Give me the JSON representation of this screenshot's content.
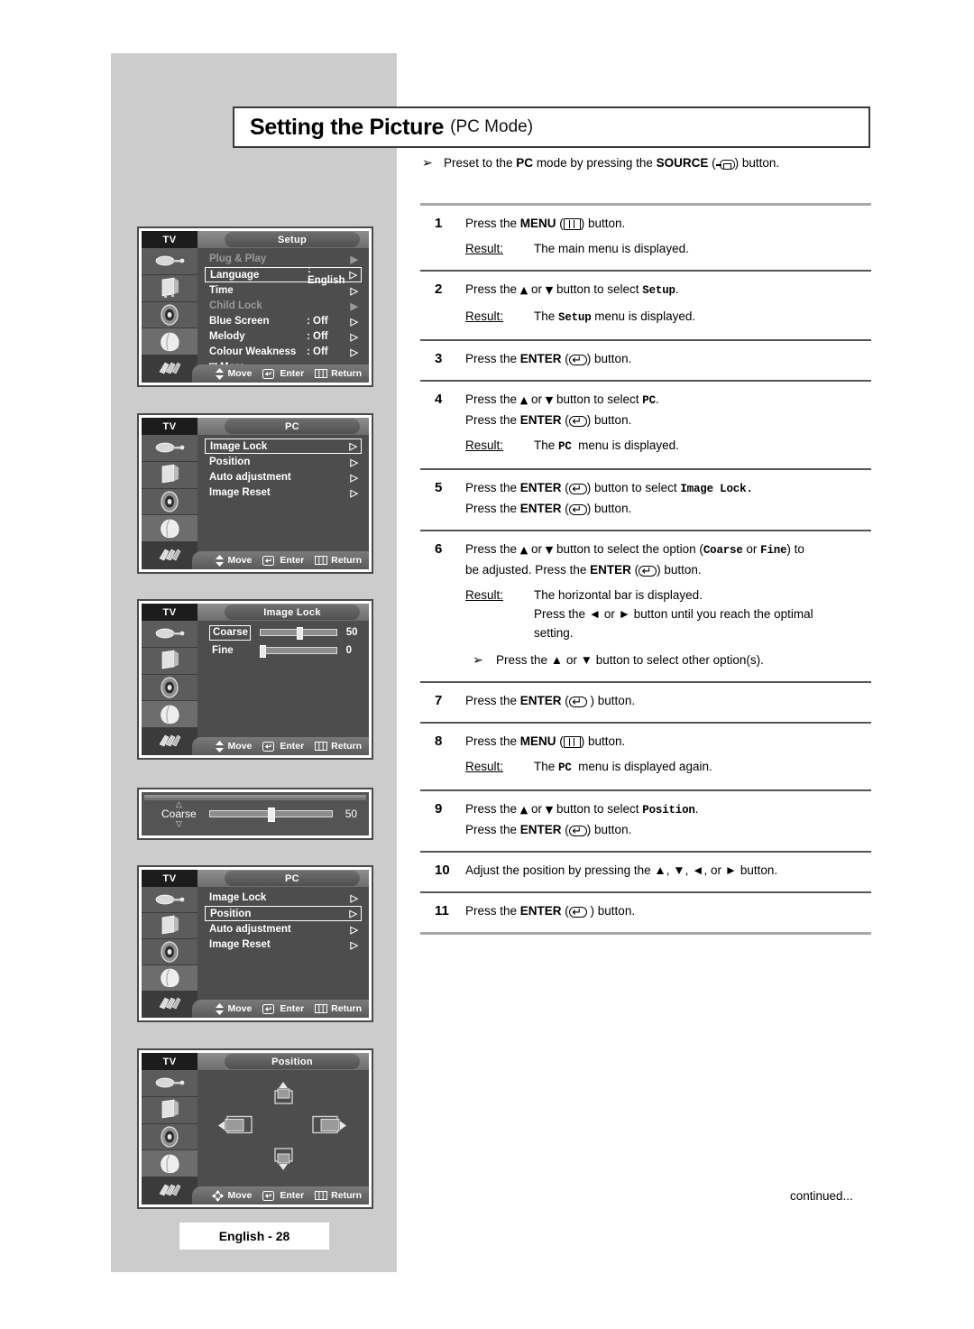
{
  "header": {
    "title_main": "Setting the Picture",
    "title_sub": "(PC Mode)"
  },
  "intro": {
    "bullet_glyph": "➢",
    "text_before": "Preset to the ",
    "bold_pc": "PC",
    "text_mid": " mode by pressing the ",
    "bold_source": "SOURCE",
    "text_after": " ) button.",
    "full": "Preset to the PC mode by pressing the SOURCE (  ) button."
  },
  "steps": [
    {
      "num": "1",
      "lines": [
        "Press the MENU (    ) button."
      ],
      "result_label": "Result:",
      "result_lines": [
        "The main menu is displayed."
      ]
    },
    {
      "num": "2",
      "lines": [
        "Press the ▲ or ▼ button to select Setup."
      ],
      "result_label": "Result:",
      "result_lines": [
        "The Setup menu is displayed."
      ]
    },
    {
      "num": "3",
      "lines": [
        "Press the ENTER (    ) button."
      ],
      "result_label": "",
      "result_lines": []
    },
    {
      "num": "4",
      "lines": [
        "Press the ▲ or ▼ button to select PC.",
        "Press the ENTER (    ) button."
      ],
      "result_label": "Result:",
      "result_lines": [
        "The PC  menu is displayed."
      ]
    },
    {
      "num": "5",
      "lines": [
        "Press the ENTER (    ) button to select Image Lock.",
        "Press the ENTER (    ) button."
      ],
      "result_label": "",
      "result_lines": []
    },
    {
      "num": "6",
      "lines": [
        "Press the ▲ or ▼ button to select the option (Coarse or Fine) to",
        "be adjusted. Press the ENTER (    ) button."
      ],
      "result_label": "Result:",
      "result_lines": [
        "The horizontal bar is displayed.",
        "Press the ◄ or ► button until you reach the optimal",
        "setting."
      ],
      "sub_bullet": "Press the ▲ or ▼ button to select other option(s)."
    },
    {
      "num": "7",
      "lines": [
        "Press the ENTER (     ) button."
      ],
      "result_label": "",
      "result_lines": []
    },
    {
      "num": "8",
      "lines": [
        "Press the MENU (    ) button."
      ],
      "result_label": "Result:",
      "result_lines": [
        "The PC  menu is displayed again."
      ]
    },
    {
      "num": "9",
      "lines": [
        "Press the ▲ or ▼ button to select Position.",
        "Press the ENTER (    ) button."
      ],
      "result_label": "",
      "result_lines": []
    },
    {
      "num": "10",
      "lines": [
        "Adjust the position by pressing the ▲, ▼, ◄, or ► button."
      ],
      "result_label": "",
      "result_lines": []
    },
    {
      "num": "11",
      "lines": [
        "Press the ENTER (     ) button."
      ],
      "result_label": "",
      "result_lines": []
    }
  ],
  "continued": "continued...",
  "page_badge": "English - 28",
  "osd_common": {
    "tv_label": "TV",
    "help_move": "Move",
    "help_enter": "Enter",
    "help_return": "Return"
  },
  "osd_setup": {
    "title": "Setup",
    "rows": [
      {
        "name": "Plug & Play",
        "value": "",
        "arrow": "▶",
        "dim": true,
        "selected": false
      },
      {
        "name": "Language",
        "value": ": English",
        "arrow": "▷",
        "dim": false,
        "selected": true
      },
      {
        "name": "Time",
        "value": "",
        "arrow": "▷",
        "dim": false,
        "selected": false
      },
      {
        "name": "Child Lock",
        "value": "",
        "arrow": "▶",
        "dim": true,
        "selected": false
      },
      {
        "name": "Blue Screen",
        "value": ": Off",
        "arrow": "▷",
        "dim": false,
        "selected": false
      },
      {
        "name": "Melody",
        "value": ": Off",
        "arrow": "▷",
        "dim": false,
        "selected": false
      },
      {
        "name": "Colour Weakness",
        "value": ": Off",
        "arrow": "▷",
        "dim": false,
        "selected": false
      }
    ],
    "more": "▽ More"
  },
  "osd_pc_1": {
    "title": "PC",
    "rows": [
      {
        "name": "Image Lock",
        "arrow": "▷",
        "selected": true
      },
      {
        "name": "Position",
        "arrow": "▷",
        "selected": false
      },
      {
        "name": "Auto adjustment",
        "arrow": "▷",
        "selected": false
      },
      {
        "name": "Image Reset",
        "arrow": "▷",
        "selected": false
      }
    ]
  },
  "osd_image_lock": {
    "title": "Image Lock",
    "sliders": [
      {
        "label": "Coarse",
        "value": "50",
        "percent": 50,
        "selected": true
      },
      {
        "label": "Fine",
        "value": "0",
        "percent": 0,
        "selected": false
      }
    ]
  },
  "osd_coarse_bar": {
    "label": "Coarse",
    "up_glyph": "△",
    "down_glyph": "▽",
    "value": "50",
    "percent": 50
  },
  "osd_pc_2": {
    "title": "PC",
    "rows": [
      {
        "name": "Image Lock",
        "arrow": "▷",
        "selected": false
      },
      {
        "name": "Position",
        "arrow": "▷",
        "selected": true
      },
      {
        "name": "Auto adjustment",
        "arrow": "▷",
        "selected": false
      },
      {
        "name": "Image Reset",
        "arrow": "▷",
        "selected": false
      }
    ]
  },
  "osd_position": {
    "title": "Position"
  },
  "colors": {
    "page_gray": "#cccccc",
    "osd_body": "#4d4d4d",
    "osd_rail": "#565656",
    "rule": "#a9a9a9"
  }
}
